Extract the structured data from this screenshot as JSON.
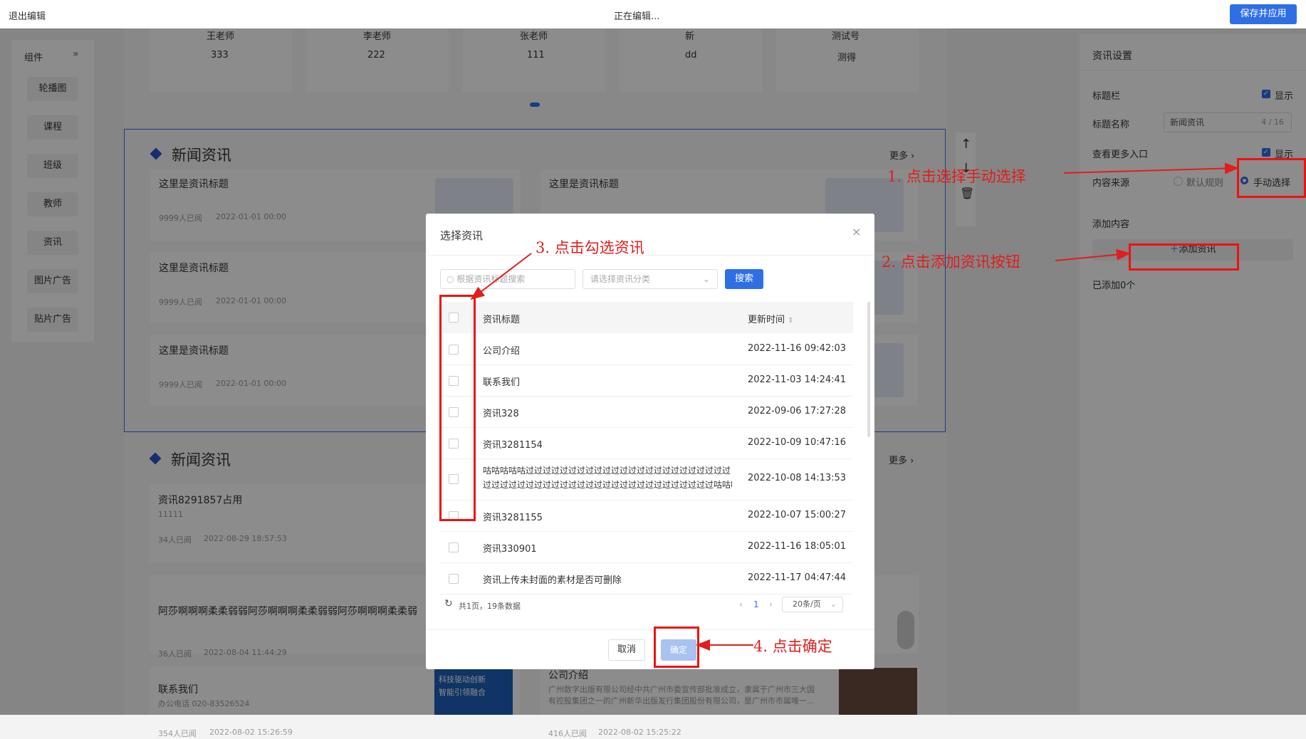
{
  "topbar": {
    "exit_label": "退出编辑",
    "status": "正在编辑...",
    "save_label": "保存并应用"
  },
  "left_panel": {
    "title": "组件",
    "items": [
      "轮播图",
      "课程",
      "班级",
      "教师",
      "资讯",
      "图片广告",
      "贴片广告"
    ]
  },
  "canvas": {
    "teachers": [
      {
        "name": "王老师",
        "value": "333"
      },
      {
        "name": "李老师",
        "value": "222"
      },
      {
        "name": "张老师",
        "value": "111"
      },
      {
        "name": "新",
        "value": "dd"
      },
      {
        "name": "测试号",
        "value": "测得"
      }
    ],
    "section1": {
      "title": "新闻资讯",
      "more": "更多",
      "item_title": "这里是资讯标题",
      "item_readers": "9999人已阅",
      "item_date": "2022-01-01 00:00"
    },
    "section2": {
      "title": "新闻资讯",
      "more": "更多",
      "items": [
        {
          "title": "资讯8291857占用",
          "sub": "11111",
          "readers": "34人已阅",
          "date": "2022-08-29 18:57:53"
        },
        {
          "title": "阿莎啊啊啊柔柔弱弱阿莎啊啊啊柔柔弱弱阿莎啊啊啊柔柔弱",
          "sub": "",
          "readers": "36人已阅",
          "date": "2022-08-04 11:44:29"
        },
        {
          "title": "联系我们",
          "sub": "办公电话 020-83526524",
          "readers": "354人已阅",
          "date": "2022-08-02 15:26:59"
        }
      ],
      "right_item": {
        "title": "公司介绍",
        "desc1": "广州数字出版有限公司经中共广州市委宣传部批准成立，隶属于广州市三大国",
        "desc2": "有控股集团之一的广州新华出版发行集团股份有限公司，是广州市市属唯一...",
        "readers": "416人已阅",
        "date": "2022-08-02 15:25:22"
      },
      "banner_text1": "科技驱动创新",
      "banner_text2": "智能引领融合"
    }
  },
  "right_panel": {
    "title": "资讯设置",
    "title_bar_label": "标题栏",
    "show_label": "显示",
    "title_name_label": "标题名称",
    "title_name_value": "新闻资讯",
    "title_name_count": "4 / 16",
    "more_entry_label": "查看更多入口",
    "show_label2": "显示",
    "source_label": "内容来源",
    "source_default": "默认规则",
    "source_manual": "手动选择",
    "add_content_label": "添加内容",
    "add_button": "添加资讯",
    "added_count": "已添加0个"
  },
  "dialog": {
    "title": "选择资讯",
    "search_placeholder": "根据资讯标题搜索",
    "category_placeholder": "请选择资讯分类",
    "search_button": "搜索",
    "col_title": "资讯标题",
    "col_time": "更新时间",
    "rows": [
      {
        "title": "公司介绍",
        "time": "2022-11-16 09:42:03"
      },
      {
        "title": "联系我们",
        "time": "2022-11-03 14:24:41"
      },
      {
        "title": "资讯328",
        "time": "2022-09-06 17:27:28"
      },
      {
        "title": "资讯3281154",
        "time": "2022-10-09 10:47:16"
      },
      {
        "title": "咕咕咕咕咕过过过过过过过过过过过过过过过过过过过过过过过过",
        "title2": "过过过过过过过过过过过过过过过过过过过过过过过过过过过咕咕咕咕...",
        "time": "2022-10-08 14:13:53"
      },
      {
        "title": "资讯3281155",
        "time": "2022-10-07 15:00:27"
      },
      {
        "title": "资讯330901",
        "time": "2022-11-16 18:05:01"
      },
      {
        "title": "资讯上传未封面的素材是否可删除",
        "time": "2022-11-17 04:47:44"
      }
    ],
    "pagination_summary": "共1页，19条数据",
    "current_page": "1",
    "page_size": "20条/页",
    "cancel": "取消",
    "confirm": "确定"
  },
  "annotations": {
    "step1": "1. 点击选择手动选择",
    "step2": "2. 点击添加资讯按钮",
    "step3": "3. 点击勾选资讯",
    "step4": "4. 点击确定"
  },
  "colors": {
    "primary": "#2f6fe4",
    "annotation_red": "#e11d1d",
    "diamond": "#2b54c8"
  }
}
